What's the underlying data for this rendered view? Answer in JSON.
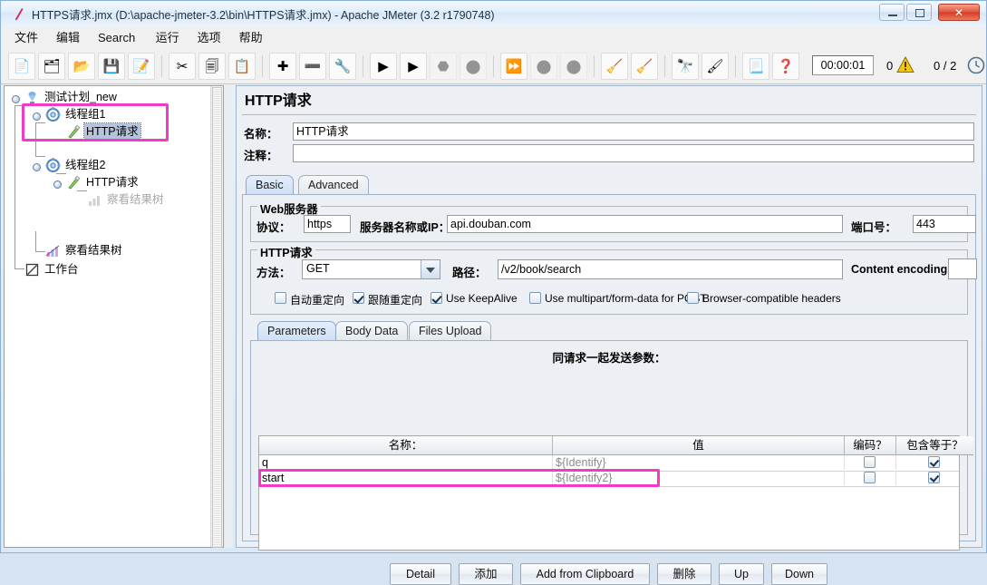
{
  "window": {
    "title": "HTTPS请求.jmx (D:\\apache-jmeter-3.2\\bin\\HTTPS请求.jmx) - Apache JMeter (3.2 r1790748)",
    "icon": "jmeter-feather-icon",
    "minimize_label": "",
    "maximize_label": "",
    "close_label": "✕"
  },
  "menu": [
    {
      "label": "文件",
      "name": "menu-file"
    },
    {
      "label": "编辑",
      "name": "menu-edit"
    },
    {
      "label": "Search",
      "name": "menu-search"
    },
    {
      "label": "运行",
      "name": "menu-run"
    },
    {
      "label": "选项",
      "name": "menu-options"
    },
    {
      "label": "帮助",
      "name": "menu-help"
    }
  ],
  "toolbar": {
    "buttons": [
      {
        "name": "new-button",
        "icon": "new-document-icon",
        "glyph": "📄",
        "disabled": false
      },
      {
        "name": "templates-button",
        "icon": "templates-icon",
        "glyph": "🗂",
        "disabled": false
      },
      {
        "name": "open-button",
        "icon": "open-folder-icon",
        "glyph": "📂",
        "disabled": false
      },
      {
        "name": "save-button",
        "icon": "save-disk-icon",
        "glyph": "💾",
        "disabled": false
      },
      {
        "name": "save-as-button",
        "icon": "save-as-icon",
        "glyph": "📝",
        "disabled": false
      },
      {
        "name": "cut-button",
        "icon": "scissors-icon",
        "glyph": "✂",
        "disabled": false
      },
      {
        "name": "copy-button",
        "icon": "copy-icon",
        "glyph": "🗐",
        "disabled": false
      },
      {
        "name": "paste-button",
        "icon": "clipboard-icon",
        "glyph": "📋",
        "disabled": false
      },
      {
        "name": "expand-all-button",
        "icon": "plus-icon",
        "glyph": "✚",
        "disabled": false
      },
      {
        "name": "collapse-all-button",
        "icon": "minus-icon",
        "glyph": "➖",
        "disabled": false
      },
      {
        "name": "toggle-button",
        "icon": "toggle-icon",
        "glyph": "🔧",
        "disabled": false
      },
      {
        "name": "start-button",
        "icon": "play-green-icon",
        "glyph": "▶",
        "disabled": false
      },
      {
        "name": "start-no-pauses-button",
        "icon": "play-no-pause-icon",
        "glyph": "▶",
        "disabled": false
      },
      {
        "name": "stop-button",
        "icon": "stop-icon",
        "glyph": "⬣",
        "disabled": true
      },
      {
        "name": "shutdown-button",
        "icon": "shutdown-icon",
        "glyph": "⬤",
        "disabled": true
      },
      {
        "name": "remote-start-all-button",
        "icon": "remote-start-icon",
        "glyph": "⏩",
        "disabled": false
      },
      {
        "name": "remote-stop-all-button",
        "icon": "remote-stop-icon",
        "glyph": "⬤",
        "disabled": true
      },
      {
        "name": "remote-shutdown-all-button",
        "icon": "remote-shutdown-icon",
        "glyph": "⬤",
        "disabled": true
      },
      {
        "name": "clear-button",
        "icon": "broom-small-icon",
        "glyph": "🧹",
        "disabled": false
      },
      {
        "name": "clear-all-button",
        "icon": "broom-all-icon",
        "glyph": "🧹",
        "disabled": false
      },
      {
        "name": "search-button",
        "icon": "binoculars-icon",
        "glyph": "🔭",
        "disabled": false
      },
      {
        "name": "search-reset-button",
        "icon": "eraser-icon",
        "glyph": "🖌",
        "disabled": false
      },
      {
        "name": "function-helper-button",
        "icon": "list-icon",
        "glyph": "📃",
        "disabled": false
      },
      {
        "name": "help-button",
        "icon": "help-book-icon",
        "glyph": "❓",
        "disabled": false
      }
    ],
    "elapsed_time": "00:00:01",
    "error_count": "0",
    "warning_icon": "warning-triangle-icon",
    "active_threads": "0 / 2",
    "clock_icon": "clock-icon"
  },
  "tree": {
    "nodes": [
      {
        "label": "测试计划_new",
        "icon": "test-plan-icon",
        "selected": false,
        "dimmed": false,
        "name": "tree-node-test-plan"
      },
      {
        "label": "线程组1",
        "icon": "thread-group-icon",
        "selected": false,
        "dimmed": false,
        "name": "tree-node-thread-group-1"
      },
      {
        "label": "HTTP请求",
        "icon": "http-request-icon",
        "selected": true,
        "dimmed": false,
        "name": "tree-node-http-request-1"
      },
      {
        "label": "线程组2",
        "icon": "thread-group-icon",
        "selected": false,
        "dimmed": false,
        "name": "tree-node-thread-group-2"
      },
      {
        "label": "HTTP请求",
        "icon": "http-request-icon",
        "selected": false,
        "dimmed": false,
        "name": "tree-node-http-request-2"
      },
      {
        "label": "察看结果树",
        "icon": "view-results-tree-icon",
        "selected": false,
        "dimmed": true,
        "name": "tree-node-view-results-tree-nested"
      },
      {
        "label": "察看结果树",
        "icon": "view-results-tree-icon",
        "selected": false,
        "dimmed": false,
        "name": "tree-node-view-results-tree"
      },
      {
        "label": "工作台",
        "icon": "workbench-icon",
        "selected": false,
        "dimmed": false,
        "name": "tree-node-workbench"
      }
    ]
  },
  "panel": {
    "title": "HTTP请求",
    "name_label": "名称：",
    "name_value": "HTTP请求",
    "comment_label": "注释：",
    "comment_value": "",
    "tabs": [
      {
        "label": "Basic",
        "active": true,
        "name": "tab-basic"
      },
      {
        "label": "Advanced",
        "active": false,
        "name": "tab-advanced"
      }
    ],
    "web_server": {
      "legend": "Web服务器",
      "protocol_label": "协议：",
      "protocol_value": "https",
      "server_label": "服务器名称或IP：",
      "server_value": "api.douban.com",
      "port_label": "端口号：",
      "port_value": "443"
    },
    "http_request": {
      "legend": "HTTP请求",
      "method_label": "方法：",
      "method_value": "GET",
      "path_label": "路径：",
      "path_value": "/v2/book/search",
      "encoding_label": "Content encoding:",
      "encoding_value": ""
    },
    "checkboxes": [
      {
        "label": "自动重定向",
        "checked": false,
        "name": "checkbox-auto-redirect"
      },
      {
        "label": "跟随重定向",
        "checked": true,
        "name": "checkbox-follow-redirect"
      },
      {
        "label": "Use KeepAlive",
        "checked": true,
        "name": "checkbox-use-keepalive"
      },
      {
        "label": "Use multipart/form-data for POST",
        "checked": false,
        "name": "checkbox-multipart"
      },
      {
        "label": "Browser-compatible headers",
        "checked": false,
        "name": "checkbox-browser-compatible"
      }
    ],
    "param_tabs": [
      {
        "label": "Parameters",
        "active": true,
        "name": "tab-parameters"
      },
      {
        "label": "Body Data",
        "active": false,
        "name": "tab-body-data"
      },
      {
        "label": "Files Upload",
        "active": false,
        "name": "tab-files-upload"
      }
    ],
    "params_caption": "同请求一起发送参数：",
    "params_table": {
      "columns": [
        "名称：",
        "值",
        "编码？",
        "包含等于？"
      ],
      "rows": [
        {
          "name": "q",
          "value": "${Identify}",
          "encode": false,
          "include_equals": true,
          "highlighted": false
        },
        {
          "name": "start",
          "value": "${Identify2}",
          "encode": false,
          "include_equals": true,
          "highlighted": true
        }
      ]
    },
    "buttons": [
      {
        "label": "Detail",
        "name": "detail-button"
      },
      {
        "label": "添加",
        "name": "add-button"
      },
      {
        "label": "Add from Clipboard",
        "name": "add-from-clipboard-button"
      },
      {
        "label": "删除",
        "name": "delete-button"
      },
      {
        "label": "Up",
        "name": "up-button"
      },
      {
        "label": "Down",
        "name": "down-button"
      }
    ]
  },
  "annotations": {
    "highlight_color": "#ee3cc8",
    "boxes": [
      "tree-selection-box",
      "param-row-box"
    ]
  }
}
